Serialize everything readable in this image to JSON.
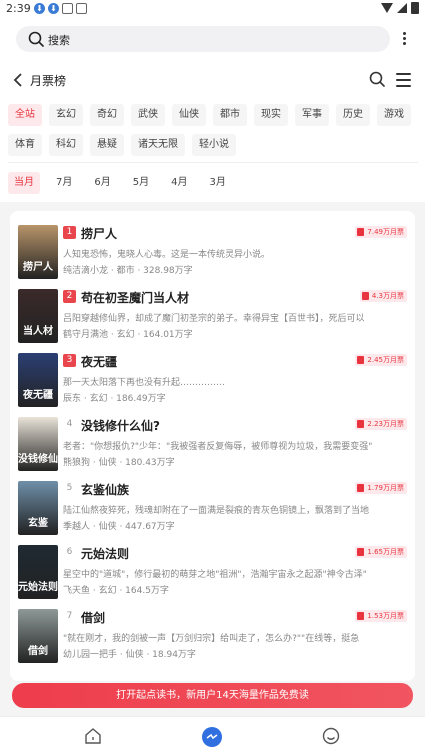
{
  "status": {
    "time": "2:39",
    "dot_glyph": "⬇"
  },
  "search": {
    "label": "搜索"
  },
  "header": {
    "title": "月票榜"
  },
  "categories": [
    "全站",
    "玄幻",
    "奇幻",
    "武侠",
    "仙侠",
    "都市",
    "现实",
    "军事",
    "历史",
    "游戏",
    "体育",
    "科幻",
    "悬疑",
    "诸天无限",
    "轻小说"
  ],
  "months": [
    "当月",
    "7月",
    "6月",
    "5月",
    "4月",
    "3月"
  ],
  "books": [
    {
      "rank": "1",
      "title": "捞尸人",
      "desc": "人知鬼恐怖，鬼晓人心毒。这是一本传统灵异小说。",
      "meta": "纯洁滴小龙 · 都市 · 328.98万字",
      "badge": "7.49万月票",
      "cover_text": "捞尸人",
      "cover_color": "#b8946a"
    },
    {
      "rank": "2",
      "title": "苟在初圣魔门当人材",
      "desc": "吕阳穿越修仙界，却成了魔门初圣宗的弟子。幸得异宝【百世书】，死后可以",
      "meta": "鹤守月满池 · 玄幻 · 164.01万字",
      "badge": "4.3万月票",
      "cover_text": "当人材",
      "cover_color": "#3b2a2a"
    },
    {
      "rank": "3",
      "title": "夜无疆",
      "desc": "那一天太阳落下再也没有升起……………",
      "meta": "辰东 · 玄幻 · 186.49万字",
      "badge": "2.45万月票",
      "cover_text": "夜无疆",
      "cover_color": "#2b3f74"
    },
    {
      "rank": "4",
      "title": "没钱修什么仙?",
      "desc": "老者：\"你想报仇?\"少年：\"我被强者反复侮辱，被师尊视为垃圾，我需要变强\"",
      "meta": "熊狼狗 · 仙侠 · 180.43万字",
      "badge": "2.23万月票",
      "cover_text": "没钱修仙",
      "cover_color": "#e9e3d8"
    },
    {
      "rank": "5",
      "title": "玄鉴仙族",
      "desc": "陆江仙熬夜猝死，残魂却附在了一面满是裂痕的青灰色铜镜上，飘落到了当地",
      "meta": "季越人 · 仙侠 · 447.67万字",
      "badge": "1.79万月票",
      "cover_text": "玄鉴",
      "cover_color": "#6f8fa9"
    },
    {
      "rank": "6",
      "title": "元始法则",
      "desc": "星空中的\"道城\"，修行最初的萌芽之地\"祖洲\"，浩瀚宇宙永之起源\"神令古泽\"",
      "meta": "飞天鱼 · 玄幻 · 164.5万字",
      "badge": "1.65万月票",
      "cover_text": "元始法则",
      "cover_color": "#1f2a33"
    },
    {
      "rank": "7",
      "title": "借剑",
      "desc": "\"就在刚才，我的剑被一声【万剑归宗】给叫走了，怎么办?\"\"在线等，挺急",
      "meta": "幼儿园一把手 · 仙侠 · 18.94万字",
      "badge": "1.53万月票",
      "cover_text": "借剑",
      "cover_color": "#8e9a98"
    }
  ],
  "cta": {
    "label": "打开起点读书，新用户14天海量作品免费读"
  }
}
